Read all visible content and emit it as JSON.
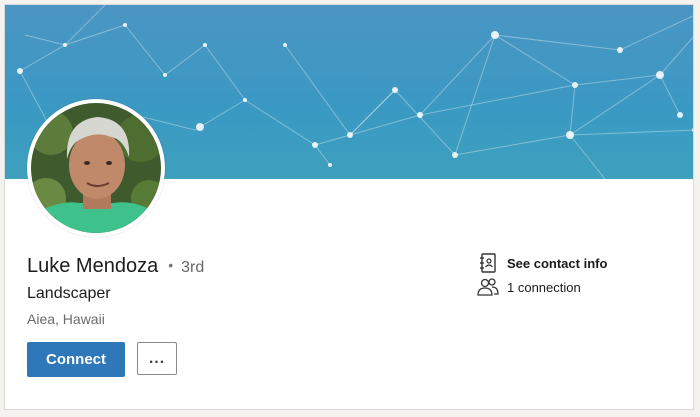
{
  "profile": {
    "name": "Luke Mendoza",
    "separator": "•",
    "degree": "3rd",
    "headline": "Landscaper",
    "location": "Aiea, Hawaii"
  },
  "actions": {
    "connect_label": "Connect",
    "more_label": "..."
  },
  "side": {
    "contact_label": "See contact info",
    "connections_label": "1 connection"
  },
  "icons": {
    "contact": "address-book-icon",
    "connections": "people-icon"
  },
  "colors": {
    "banner": "#3a99c3",
    "connect_button": "#2e77b8",
    "avatar_shirt": "#3fc18b"
  }
}
